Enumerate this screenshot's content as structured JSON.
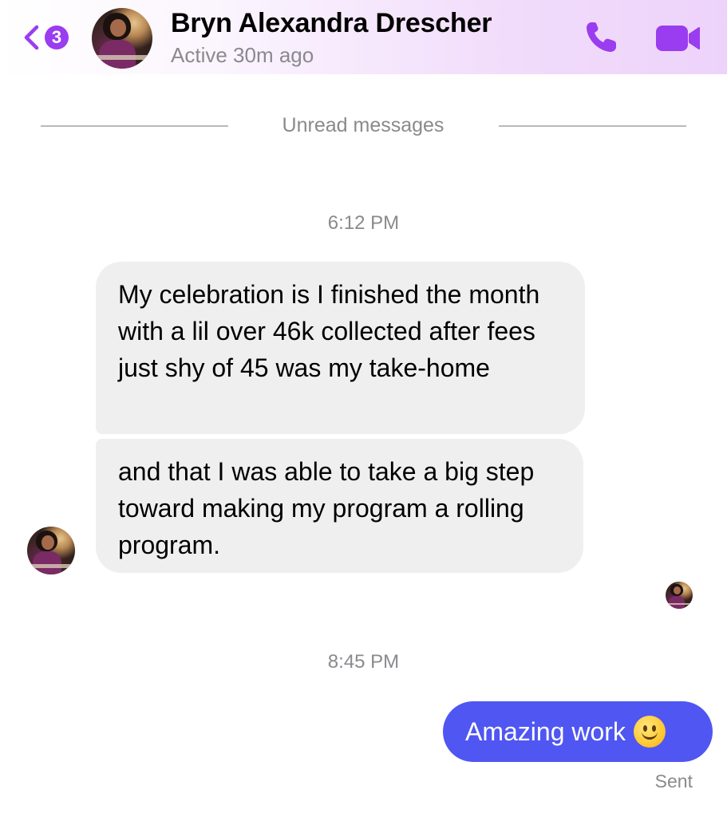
{
  "header": {
    "unread_count": "3",
    "contact_name": "Bryn Alexandra Drescher",
    "status": "Active 30m ago",
    "accent_color": "#9a3cf0"
  },
  "icons": {
    "back": "chevron-left-icon",
    "call": "phone-icon",
    "video": "video-camera-icon",
    "emoji": "slightly-smiling-face-emoji"
  },
  "thread": {
    "unread_divider": "Unread messages",
    "timestamp_1": "6:12 PM",
    "incoming_messages": [
      {
        "text": "My celebration is I finished the month with a lil over 46k collected after fees just shy of 45 was my take-home"
      },
      {
        "text": "and that I was able to take a big step toward making my program a rolling program."
      }
    ],
    "timestamp_2": "8:45 PM",
    "outgoing_message": {
      "text": "Amazing work"
    },
    "delivery_status": "Sent",
    "colors": {
      "incoming_bubble": "#efefef",
      "outgoing_bubble": "#4f56f2"
    }
  }
}
